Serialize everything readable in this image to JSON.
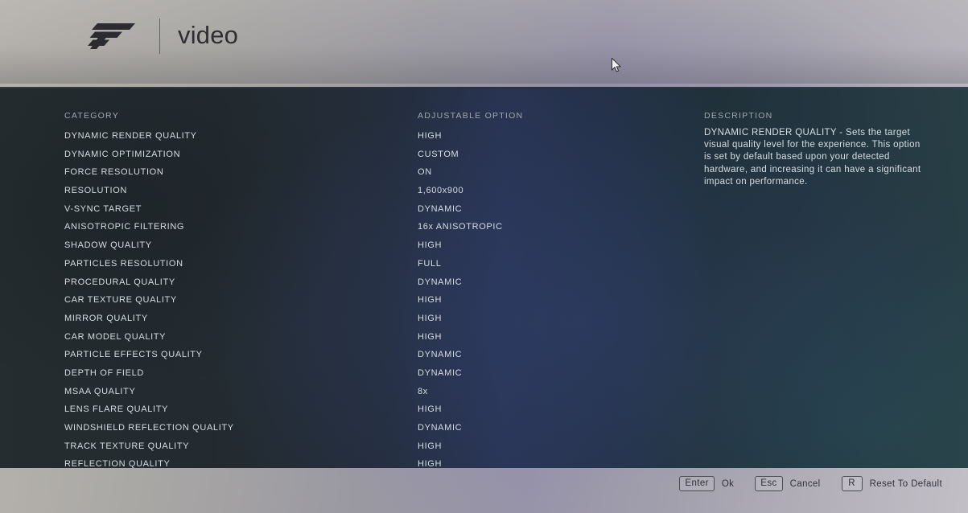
{
  "header": {
    "brand_logo": "forza-logo",
    "title": "video"
  },
  "columns": {
    "category": "CATEGORY",
    "option": "ADJUSTABLE OPTION",
    "description": "DESCRIPTION"
  },
  "settings": [
    {
      "category": "DYNAMIC RENDER QUALITY",
      "value": "HIGH"
    },
    {
      "category": "DYNAMIC OPTIMIZATION",
      "value": "CUSTOM"
    },
    {
      "category": "FORCE RESOLUTION",
      "value": "ON"
    },
    {
      "category": "RESOLUTION",
      "value": "1,600x900"
    },
    {
      "category": "V-SYNC TARGET",
      "value": "DYNAMIC"
    },
    {
      "category": "ANISOTROPIC FILTERING",
      "value": "16x ANISOTROPIC"
    },
    {
      "category": "SHADOW QUALITY",
      "value": "HIGH"
    },
    {
      "category": "PARTICLES RESOLUTION",
      "value": "FULL"
    },
    {
      "category": "PROCEDURAL QUALITY",
      "value": "DYNAMIC"
    },
    {
      "category": "CAR TEXTURE QUALITY",
      "value": "HIGH"
    },
    {
      "category": "MIRROR QUALITY",
      "value": "HIGH"
    },
    {
      "category": "CAR MODEL QUALITY",
      "value": "HIGH"
    },
    {
      "category": "PARTICLE EFFECTS QUALITY",
      "value": "DYNAMIC"
    },
    {
      "category": "DEPTH OF FIELD",
      "value": "DYNAMIC"
    },
    {
      "category": "MSAA QUALITY",
      "value": "8x"
    },
    {
      "category": "LENS FLARE QUALITY",
      "value": "HIGH"
    },
    {
      "category": "WINDSHIELD REFLECTION QUALITY",
      "value": "DYNAMIC"
    },
    {
      "category": "TRACK TEXTURE QUALITY",
      "value": "HIGH"
    },
    {
      "category": "REFLECTION QUALITY",
      "value": "HIGH"
    }
  ],
  "description_text": "DYNAMIC RENDER QUALITY - Sets the target visual quality level for the experience. This option is set by default based upon your detected hardware, and increasing it can have a significant impact on performance.",
  "footer_keys": [
    {
      "key": "Enter",
      "label": "Ok"
    },
    {
      "key": "Esc",
      "label": "Cancel"
    },
    {
      "key": "R",
      "label": "Reset To Default"
    }
  ],
  "colors": {
    "panel_left": "#20282c",
    "panel_mid": "#222e4d",
    "panel_right": "#20383e",
    "text_primary": "#d5dde1",
    "text_muted": "#9fa8ad",
    "footer_text": "#33333a"
  }
}
